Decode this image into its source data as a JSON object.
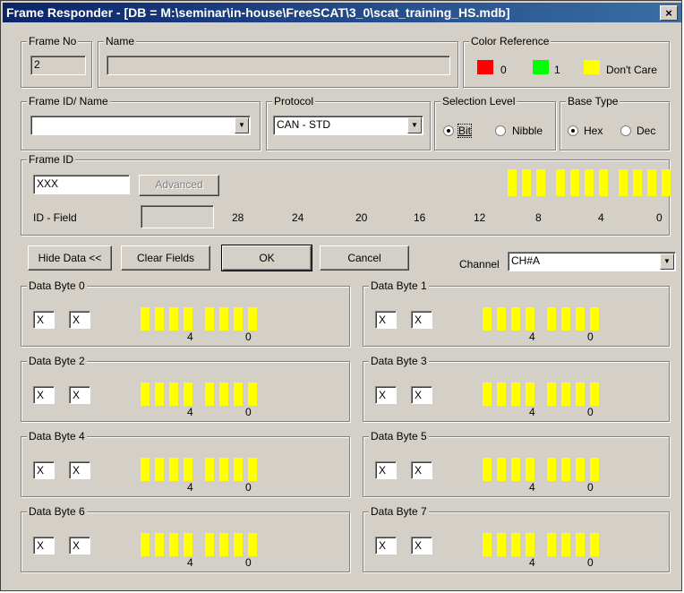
{
  "window": {
    "title": "Frame Responder - [DB = M:\\seminar\\in-house\\FreeSCAT\\3_0\\scat_training_HS.mdb]",
    "close": "×"
  },
  "frame_no": {
    "label": "Frame No",
    "value": "2"
  },
  "name": {
    "label": "Name",
    "value": ""
  },
  "color_reference": {
    "label": "Color Reference",
    "items": [
      {
        "color": "#ff0000",
        "text": "0"
      },
      {
        "color": "#00ff00",
        "text": "1"
      },
      {
        "color": "#ffff00",
        "text": "Don't Care"
      }
    ]
  },
  "frame_id_name": {
    "label": "Frame ID/ Name",
    "value": ""
  },
  "protocol": {
    "label": "Protocol",
    "value": "CAN - STD"
  },
  "selection_level": {
    "label": "Selection Level",
    "options": [
      "Bit",
      "Nibble"
    ],
    "selected": "Bit"
  },
  "base_type": {
    "label": "Base Type",
    "options": [
      "Hex",
      "Dec"
    ],
    "selected": "Hex"
  },
  "frame_id": {
    "label": "Frame ID",
    "value": "XXX",
    "advanced_label": "Advanced",
    "id_field_label": "ID - Field",
    "id_field_value": "",
    "bit_positions": [
      "28",
      "24",
      "20",
      "16",
      "12",
      "8",
      "4",
      "0"
    ],
    "bits_state": "Don't Care",
    "bit_count": 11
  },
  "buttons": {
    "hide_data": "Hide Data <<",
    "clear_fields": "Clear Fields",
    "ok": "OK",
    "cancel": "Cancel"
  },
  "channel": {
    "label": "Channel",
    "value": "CH#A"
  },
  "data_bytes": [
    {
      "label": "Data Byte 0",
      "hi": "X",
      "lo": "X",
      "pos_hi": "4",
      "pos_lo": "0"
    },
    {
      "label": "Data Byte 1",
      "hi": "X",
      "lo": "X",
      "pos_hi": "4",
      "pos_lo": "0"
    },
    {
      "label": "Data Byte 2",
      "hi": "X",
      "lo": "X",
      "pos_hi": "4",
      "pos_lo": "0"
    },
    {
      "label": "Data Byte 3",
      "hi": "X",
      "lo": "X",
      "pos_hi": "4",
      "pos_lo": "0"
    },
    {
      "label": "Data Byte 4",
      "hi": "X",
      "lo": "X",
      "pos_hi": "4",
      "pos_lo": "0"
    },
    {
      "label": "Data Byte 5",
      "hi": "X",
      "lo": "X",
      "pos_hi": "4",
      "pos_lo": "0"
    },
    {
      "label": "Data Byte 6",
      "hi": "X",
      "lo": "X",
      "pos_hi": "4",
      "pos_lo": "0"
    },
    {
      "label": "Data Byte 7",
      "hi": "X",
      "lo": "X",
      "pos_hi": "4",
      "pos_lo": "0"
    }
  ],
  "icons": {
    "dropdown": "chevron-down-icon"
  }
}
